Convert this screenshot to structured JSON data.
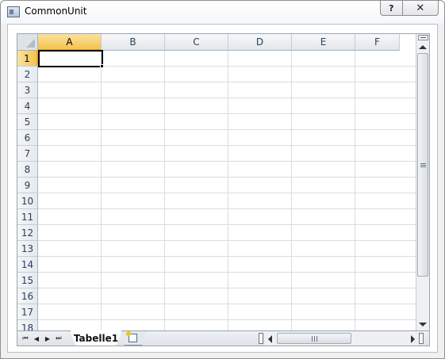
{
  "window": {
    "title": "CommonUnit",
    "help_label": "?",
    "close_label": "✕"
  },
  "spreadsheet": {
    "columns": [
      "A",
      "B",
      "C",
      "D",
      "E",
      "F"
    ],
    "rows": [
      "1",
      "2",
      "3",
      "4",
      "5",
      "6",
      "7",
      "8",
      "9",
      "10",
      "11",
      "12",
      "13",
      "14",
      "15",
      "16",
      "17",
      "18"
    ],
    "active_cell": "A1",
    "active_column": "A",
    "active_row": "1"
  },
  "tabs": {
    "nav_first": "⏮",
    "nav_prev": "◀",
    "nav_next": "▶",
    "nav_last": "⏭",
    "sheets": [
      "Tabelle1"
    ],
    "active_sheet": "Tabelle1"
  },
  "icons": {
    "app": "window-app-icon",
    "new_sheet": "insert-sheet-icon"
  },
  "colors": {
    "active_header": "#f4c24f",
    "header_text": "#27415f",
    "gridline": "#dadcdd"
  }
}
